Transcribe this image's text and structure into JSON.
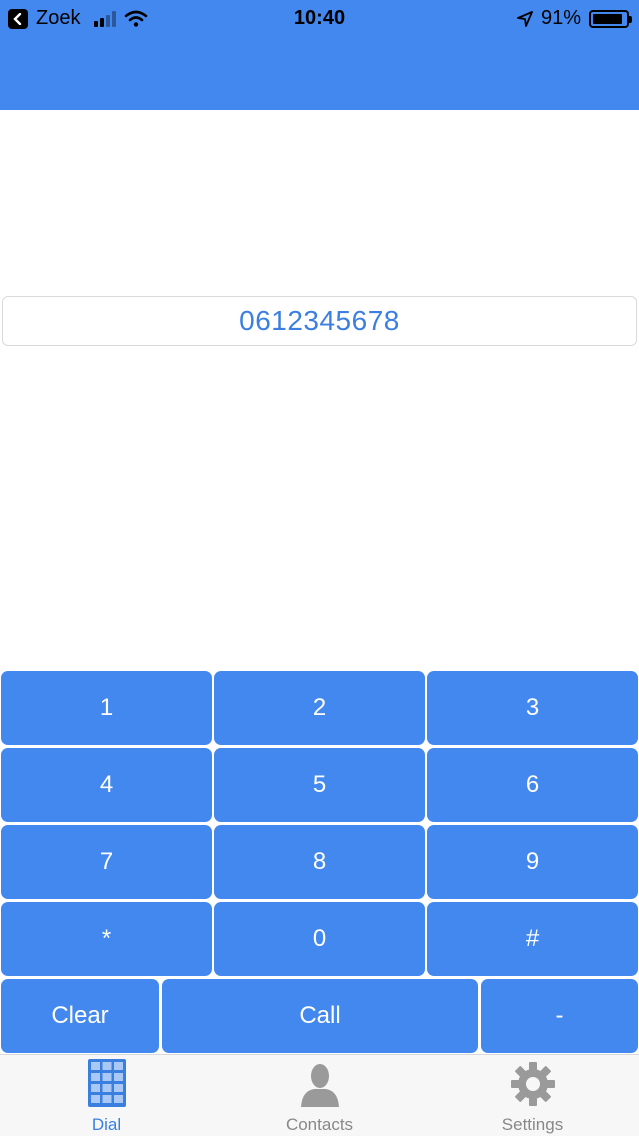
{
  "status_bar": {
    "carrier": "Zoek",
    "time": "10:40",
    "battery": "91%",
    "battery_level": 0.91
  },
  "display": {
    "number": "0612345678"
  },
  "keypad": {
    "rows": [
      [
        "1",
        "2",
        "3"
      ],
      [
        "4",
        "5",
        "6"
      ],
      [
        "7",
        "8",
        "9"
      ],
      [
        "*",
        "0",
        "#"
      ]
    ],
    "bottom": [
      "Clear",
      "Call",
      "-"
    ]
  },
  "tabs": [
    {
      "label": "Dial",
      "icon": "dialpad-icon",
      "active": true
    },
    {
      "label": "Contacts",
      "icon": "person-icon",
      "active": false
    },
    {
      "label": "Settings",
      "icon": "gear-icon",
      "active": false
    }
  ],
  "colors": {
    "accent": "#4388ee",
    "active_tab": "#3a7fe0",
    "inactive_tab": "#888888"
  }
}
